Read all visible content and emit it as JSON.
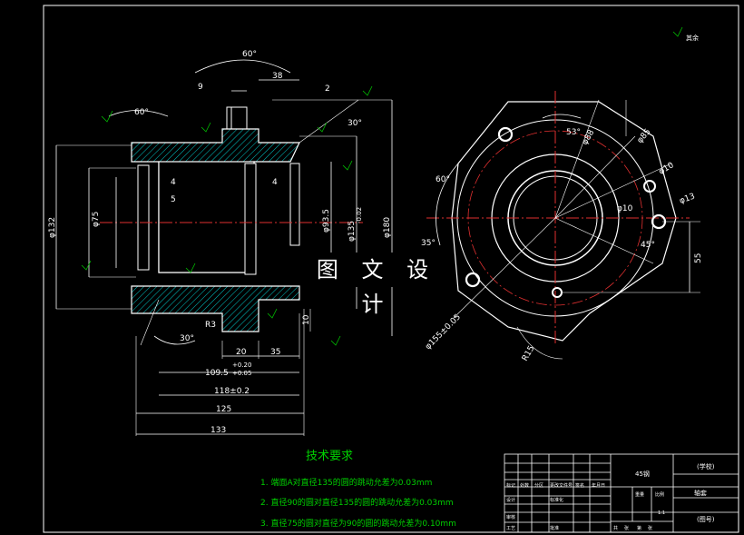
{
  "watermark": "图 文 设 计",
  "roughness_corner": "其余",
  "dims": {
    "angle_60_top": "60°",
    "d38": "38",
    "d9": "9",
    "angle_60_left": "60°",
    "d2": "2",
    "angle_30_right": "30°",
    "d4a": "4",
    "d5": "5",
    "d4b": "4",
    "phi132": "φ132",
    "phi75": "φ75",
    "phi93_5": "φ93.5",
    "phi135": "φ135",
    "phi135_tol": "-0.02",
    "phi180": "φ180",
    "r3": "R3",
    "angle_30_bottom": "30°",
    "d10": "10",
    "d20": "20",
    "d35": "35",
    "d109": "109.5",
    "d109_tol_up": "+0.20",
    "d109_tol_dn": "+0.05",
    "d118": "118±0.2",
    "d125": "125",
    "d133": "133",
    "angle_53": "53°",
    "angle_60_side": "60°",
    "angle_35": "35°",
    "angle_45": "45°",
    "phi88": "φ88",
    "phi85": "φ85",
    "phi10": "φ10",
    "phi10b": "φ10",
    "phi13": "φ13",
    "d55": "55",
    "phi155": "φ155±0.05",
    "r15": "R15"
  },
  "tech": {
    "title": "技术要求",
    "items": [
      "1. 端面A对直径135的圆的跳动允差为0.03mm",
      "2. 直径90的圆对直径135的圆的跳动允差为0.03mm",
      "3. 直径75的圆对直径为90的圆的跳动允差为0.10mm"
    ]
  },
  "titleblock": {
    "material": "45钢",
    "school": "(学校)",
    "part_name": "轴套",
    "drawing_no": "(图号)",
    "weight_label": "重量",
    "scale_label": "比例",
    "scale": "1:1",
    "labels": [
      "标记",
      "处数",
      "分区",
      "更改文件号",
      "签名",
      "年月日",
      "设计",
      "标准化",
      "审核",
      "工艺",
      "批准",
      "共",
      "张",
      "第",
      "张"
    ]
  }
}
